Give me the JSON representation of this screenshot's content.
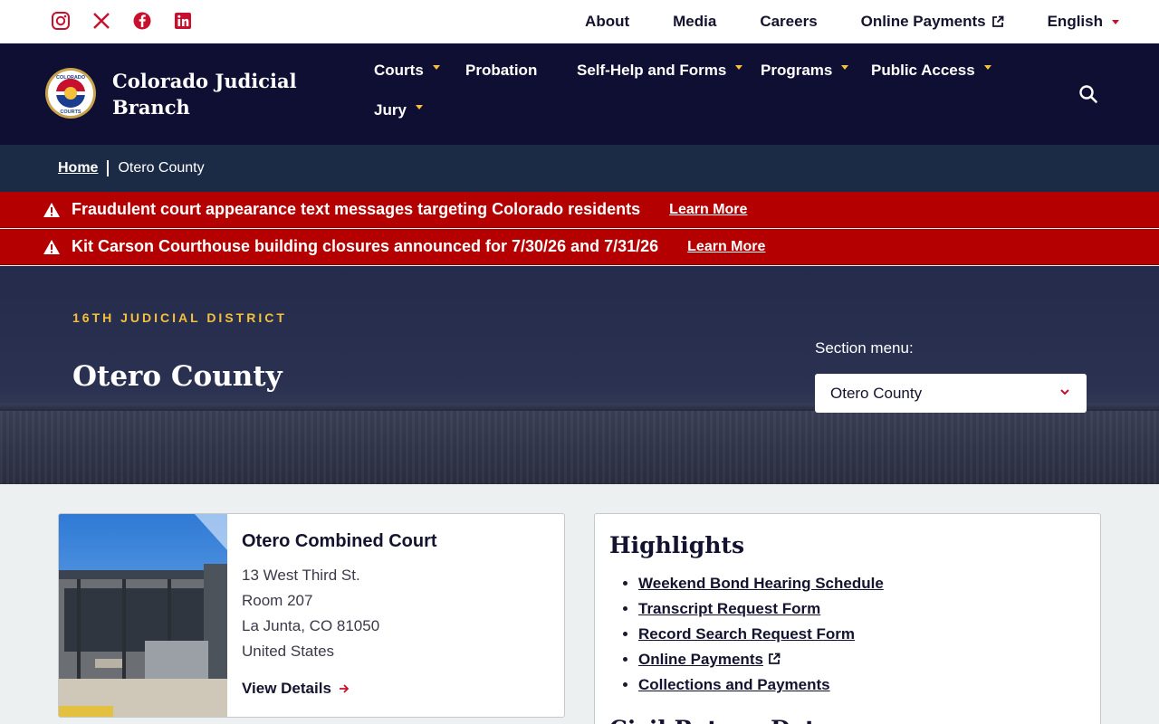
{
  "utility": {
    "social": [
      "instagram-icon",
      "x-icon",
      "facebook-icon",
      "linkedin-icon"
    ],
    "links": [
      "About",
      "Media",
      "Careers",
      "Online Payments",
      "English"
    ]
  },
  "header": {
    "brand": "Colorado Judicial Branch",
    "logo_text": [
      "COLORADO",
      "COURTS"
    ],
    "nav": [
      "Courts",
      "Probation",
      "Self-Help and Forms",
      "Programs",
      "Public Access",
      "Jury"
    ]
  },
  "breadcrumb": {
    "home": "Home",
    "current": "Otero County"
  },
  "alerts": [
    {
      "message": "Fraudulent court appearance text messages targeting Colorado residents",
      "link": "Learn More"
    },
    {
      "message": "Kit Carson Courthouse building closures announced for 7/30/26 and 7/31/26",
      "link": "Learn More"
    }
  ],
  "hero": {
    "district": "16TH JUDICIAL DISTRICT",
    "title": "Otero County",
    "section_label": "Section menu:",
    "section_value": "Otero County"
  },
  "court": {
    "name": "Otero Combined Court",
    "address": [
      "13 West Third St.",
      "Room 207",
      "La Junta, CO 81050",
      "United States"
    ],
    "details_link": "View Details"
  },
  "highlights": {
    "title": "Highlights",
    "items": [
      "Weekend Bond Hearing Schedule",
      "Transcript Request Form",
      "Record Search Request Form",
      "Online Payments",
      "Collections and Payments"
    ],
    "next_title": "Civil Return Dates"
  },
  "colors": {
    "navy": "#0f0f33",
    "alert": "#b40000",
    "gold": "#f5c13a",
    "accent_red": "#c8102e"
  }
}
